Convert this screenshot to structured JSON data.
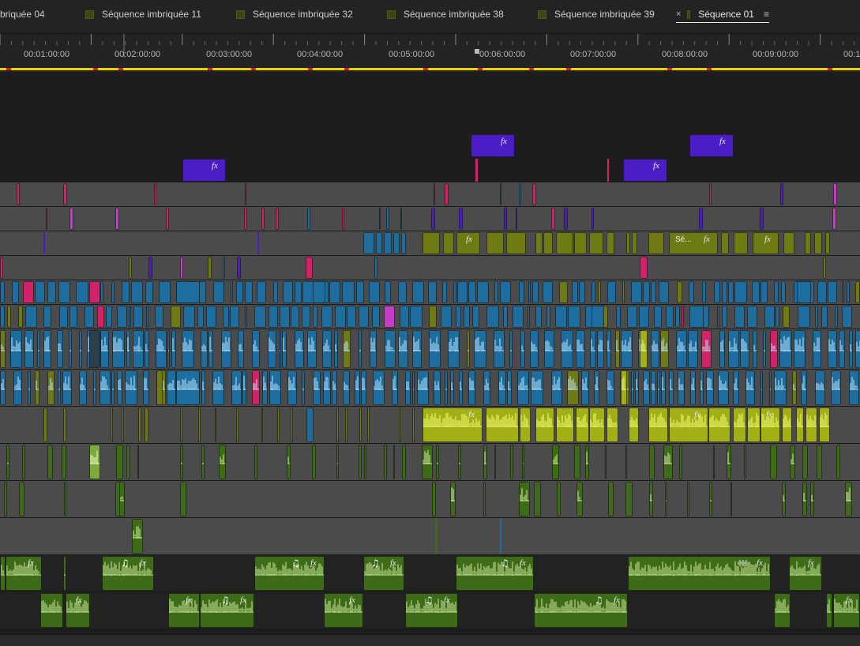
{
  "tabs": [
    {
      "label": "briquée 04",
      "swatch": false,
      "active": false
    },
    {
      "label": "Séquence imbriquée 11",
      "swatch": true,
      "active": false
    },
    {
      "label": "Séquence imbriquée 32",
      "swatch": true,
      "active": false
    },
    {
      "label": "Séquence imbriquée 38",
      "swatch": true,
      "active": false
    },
    {
      "label": "Séquence imbriquée 39",
      "swatch": true,
      "active": false
    },
    {
      "label": "Séquence 01",
      "swatch": true,
      "active": true,
      "close_glyph": "×",
      "menu_glyph": "≡"
    }
  ],
  "ruler": {
    "labels": [
      "00:01:00:00",
      "00:02:00:00",
      "00:03:00:00",
      "00:04:00:00",
      "00:05:00:00",
      "00:06:00:00",
      "00:07:00:00",
      "00:08:00:00",
      "00:09:00:00",
      "00:1"
    ]
  },
  "clip_text": {
    "fx": "fx",
    "music": "♫",
    "seq_label": "Sé..."
  },
  "colors": {
    "blue": "#1d6e9e",
    "purple": "#4a1ec4",
    "magenta": "#d1226a",
    "olive": "#6f7a14",
    "lime": "#a3b015",
    "green": "#3d6b17",
    "lightgreen": "#7bab3a",
    "pink": "#c43ec8",
    "track_bg": "#4b4b4b",
    "empty_track": "#1d1d1d",
    "work_area": "#e8d400"
  },
  "icons": {
    "close": "close-icon",
    "menu": "menu-icon",
    "sequence_swatch": "sequence-color-swatch-icon",
    "fx": "fx-badge-icon",
    "music": "music-note-icon",
    "playhead": "playhead-icon"
  }
}
